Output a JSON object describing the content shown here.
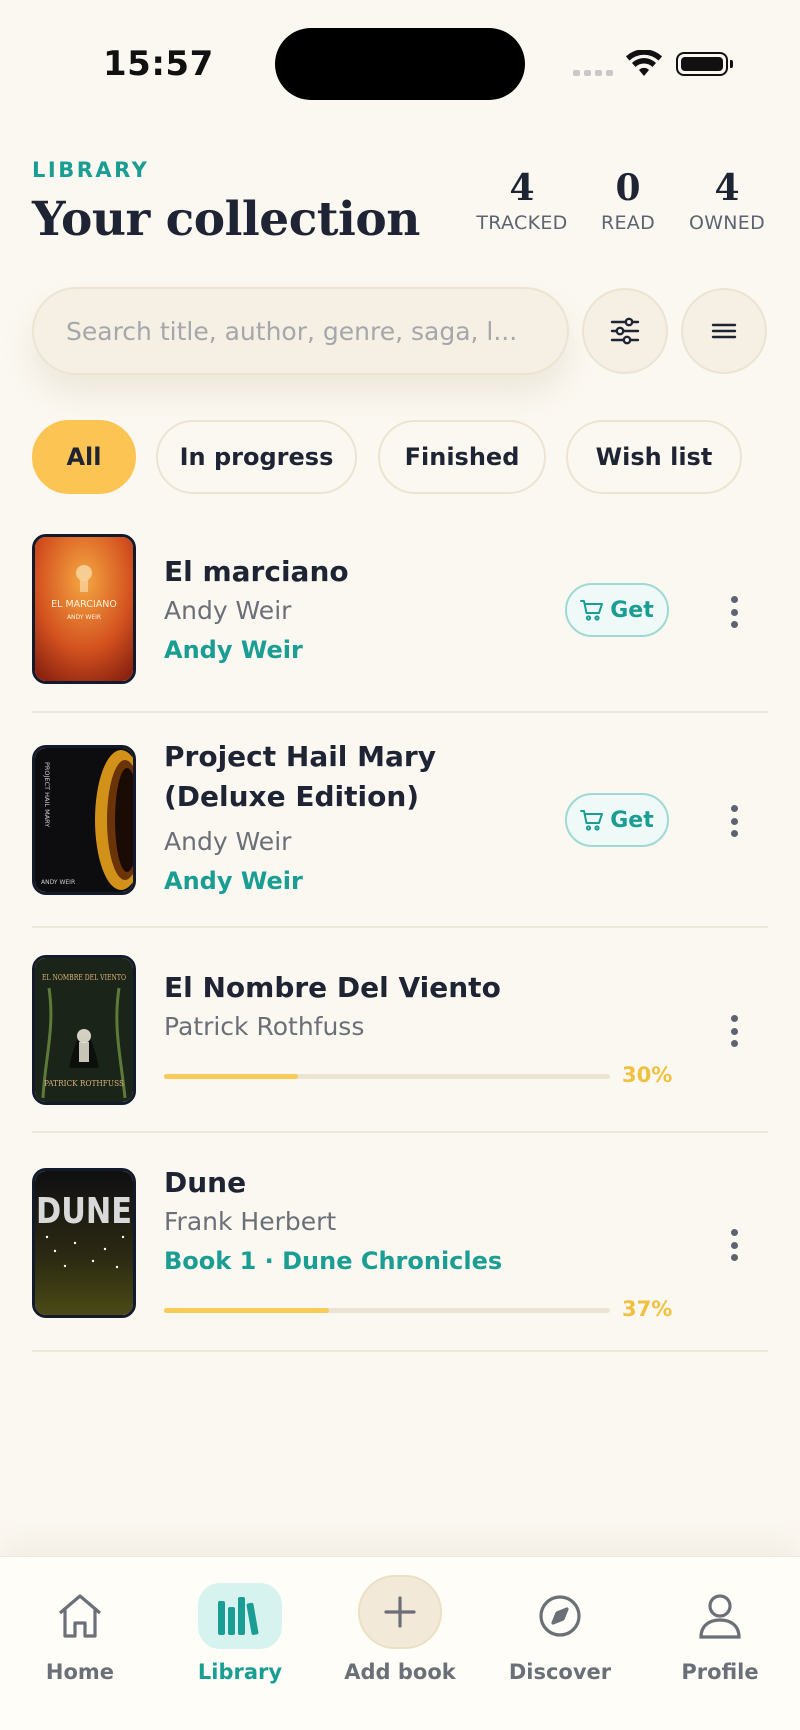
{
  "status_bar": {
    "time": "15:57"
  },
  "header": {
    "eyebrow": "LIBRARY",
    "title": "Your collection",
    "stats": [
      {
        "value": "4",
        "label": "TRACKED"
      },
      {
        "value": "0",
        "label": "READ"
      },
      {
        "value": "4",
        "label": "OWNED"
      }
    ]
  },
  "search": {
    "placeholder": "Search title, author, genre, saga, l...",
    "value": ""
  },
  "filters": [
    {
      "label": "All",
      "active": true
    },
    {
      "label": "In progress",
      "active": false
    },
    {
      "label": "Finished",
      "active": false
    },
    {
      "label": "Wish list",
      "active": false
    }
  ],
  "books": [
    {
      "title": "El marciano",
      "author": "Andy Weir",
      "series": "Andy Weir",
      "action": "Get",
      "cover_text": "EL MARCIANO",
      "cover_sub": "ANDY WEIR"
    },
    {
      "title": "Project Hail Mary (Deluxe Edition)",
      "author": "Andy Weir",
      "series": "Andy Weir",
      "action": "Get",
      "cover_text": "PROJECT HAIL MARY",
      "cover_sub": "ANDY WEIR"
    },
    {
      "title": "El Nombre Del Viento",
      "author": "Patrick Rothfuss",
      "progress": 0.3,
      "progress_label": "30%",
      "cover_text": "EL NOMBRE DEL VIENTO",
      "cover_sub": "PATRICK ROTHFUSS"
    },
    {
      "title": "Dune",
      "author": "Frank Herbert",
      "series": "Book 1 · Dune Chronicles",
      "progress": 0.37,
      "progress_label": "37%",
      "cover_text": "DUNE"
    }
  ],
  "nav": [
    {
      "label": "Home",
      "icon": "home-icon",
      "active": false
    },
    {
      "label": "Library",
      "icon": "library-icon",
      "active": true
    },
    {
      "label": "Add book",
      "icon": "plus-icon",
      "active": false
    },
    {
      "label": "Discover",
      "icon": "compass-icon",
      "active": false
    },
    {
      "label": "Profile",
      "icon": "user-icon",
      "active": false
    }
  ],
  "colors": {
    "accent": "#1a9e93",
    "chip_active": "#fcc553",
    "progress": "#f6cb57",
    "background": "#fbf8f1"
  }
}
